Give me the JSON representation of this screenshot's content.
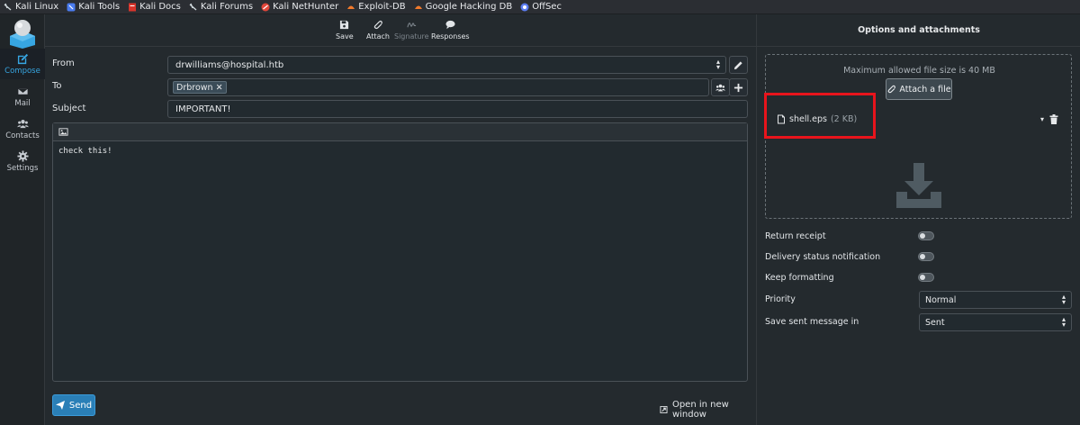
{
  "bookmarks": [
    {
      "label": "Kali Linux",
      "icon": "kali-dragon-icon",
      "color": "#cfd8dc"
    },
    {
      "label": "Kali Tools",
      "icon": "kali-tools-icon",
      "color": "#4a7cf0"
    },
    {
      "label": "Kali Docs",
      "icon": "kali-docs-icon",
      "color": "#d9342b"
    },
    {
      "label": "Kali Forums",
      "icon": "kali-forums-icon",
      "color": "#cfd8dc"
    },
    {
      "label": "Kali NetHunter",
      "icon": "nethunter-icon",
      "color": "#e0463a"
    },
    {
      "label": "Exploit-DB",
      "icon": "exploitdb-icon",
      "color": "#f27a2c"
    },
    {
      "label": "Google Hacking DB",
      "icon": "ghdb-icon",
      "color": "#f27a2c"
    },
    {
      "label": "OffSec",
      "icon": "offsec-icon",
      "color": "#5b7cf0"
    }
  ],
  "nav": {
    "compose": "Compose",
    "mail": "Mail",
    "contacts": "Contacts",
    "settings": "Settings"
  },
  "toolbar": {
    "save": "Save",
    "attach": "Attach",
    "signature": "Signature",
    "responses": "Responses"
  },
  "form": {
    "from_label": "From",
    "from_value": "drwilliams@hospital.htb",
    "to_label": "To",
    "to_recipient": "Drbrown",
    "subject_label": "Subject",
    "subject_value": "IMPORTANT!",
    "body": "check this!"
  },
  "actions": {
    "send": "Send",
    "open_new_window": "Open in new window"
  },
  "options": {
    "title": "Options and attachments",
    "max_size": "Maximum allowed file size is 40 MB",
    "attach_file": "Attach a file",
    "attachment_name": "shell.eps",
    "attachment_size": "(2 KB)",
    "return_receipt": "Return receipt",
    "delivery_status": "Delivery status notification",
    "keep_formatting": "Keep formatting",
    "priority_label": "Priority",
    "priority_value": "Normal",
    "save_sent_label": "Save sent message in",
    "save_sent_value": "Sent"
  },
  "colors": {
    "accent": "#37a6e2",
    "send_button": "#2a7fb7",
    "highlight_box": "#e8141c"
  }
}
